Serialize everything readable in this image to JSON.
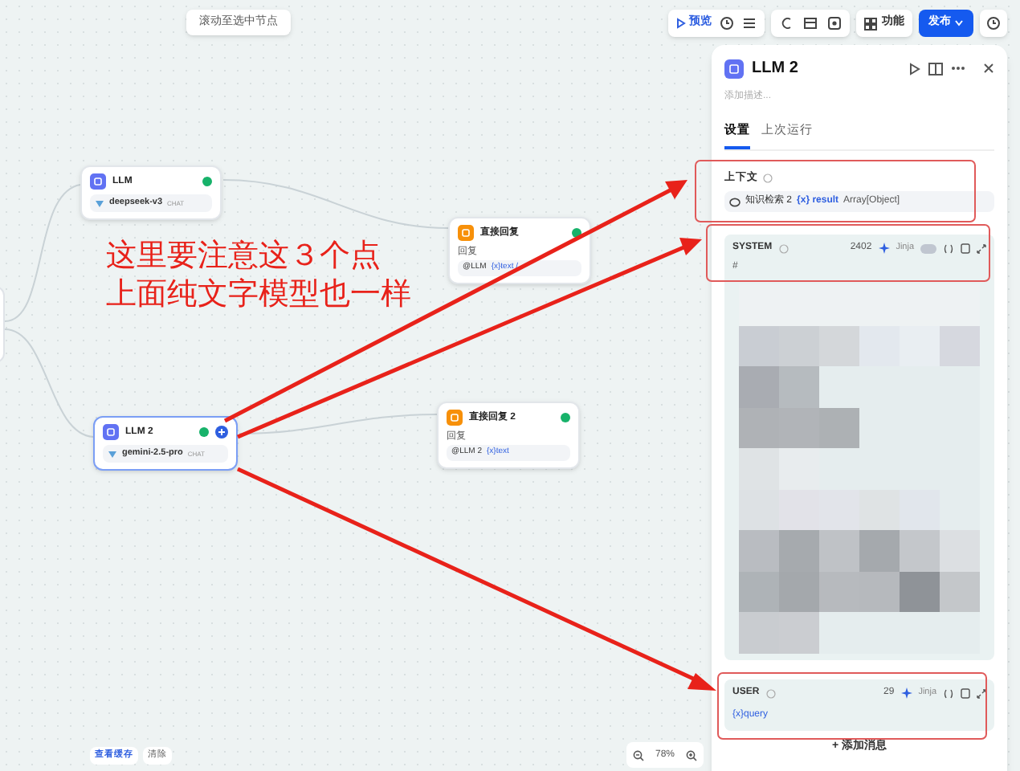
{
  "canvas_top": {
    "scroll_button": "滚动至选中节点"
  },
  "toolbar": {
    "preview": "预览",
    "features": "功能",
    "publish": "发布"
  },
  "nodes": [
    {
      "kind": "llm",
      "title": "LLM",
      "model": "deepseek-v3",
      "mode": "CHAT",
      "selected": false
    },
    {
      "kind": "answer",
      "title": "直接回复",
      "label": "回复",
      "ref": "@LLM",
      "var": "{x}text /",
      "selected": false
    },
    {
      "kind": "llm",
      "title": "LLM 2",
      "model": "gemini-2.5-pro",
      "mode": "CHAT",
      "selected": true
    },
    {
      "kind": "answer",
      "title": "直接回复 2",
      "label": "回复",
      "ref": "@LLM 2",
      "var": "{x}text",
      "selected": false
    }
  ],
  "annotation": {
    "lines": [
      "这里要注意这３个点",
      "上面纯文字模型也一样"
    ]
  },
  "panel": {
    "title": "LLM 2",
    "description_placeholder": "添加描述...",
    "tabs": [
      {
        "label": "设置",
        "selected": true
      },
      {
        "label": "上次运行",
        "selected": false
      }
    ],
    "context": {
      "label": "上下文",
      "source": "知识检索 2",
      "var": "{x} result",
      "type": "Array[Object]"
    },
    "system": {
      "role": "SYSTEM",
      "count": "2402",
      "jinja": "Jinja",
      "jinja_on": false,
      "first_line": "# "
    },
    "user": {
      "role": "USER",
      "count": "29",
      "jinja": "Jinja",
      "var": "{x}query"
    },
    "add_message": "+ 添加消息"
  },
  "bottom": {
    "view_cache": "查看缓存",
    "clear": "清除",
    "zoom": "78%"
  }
}
